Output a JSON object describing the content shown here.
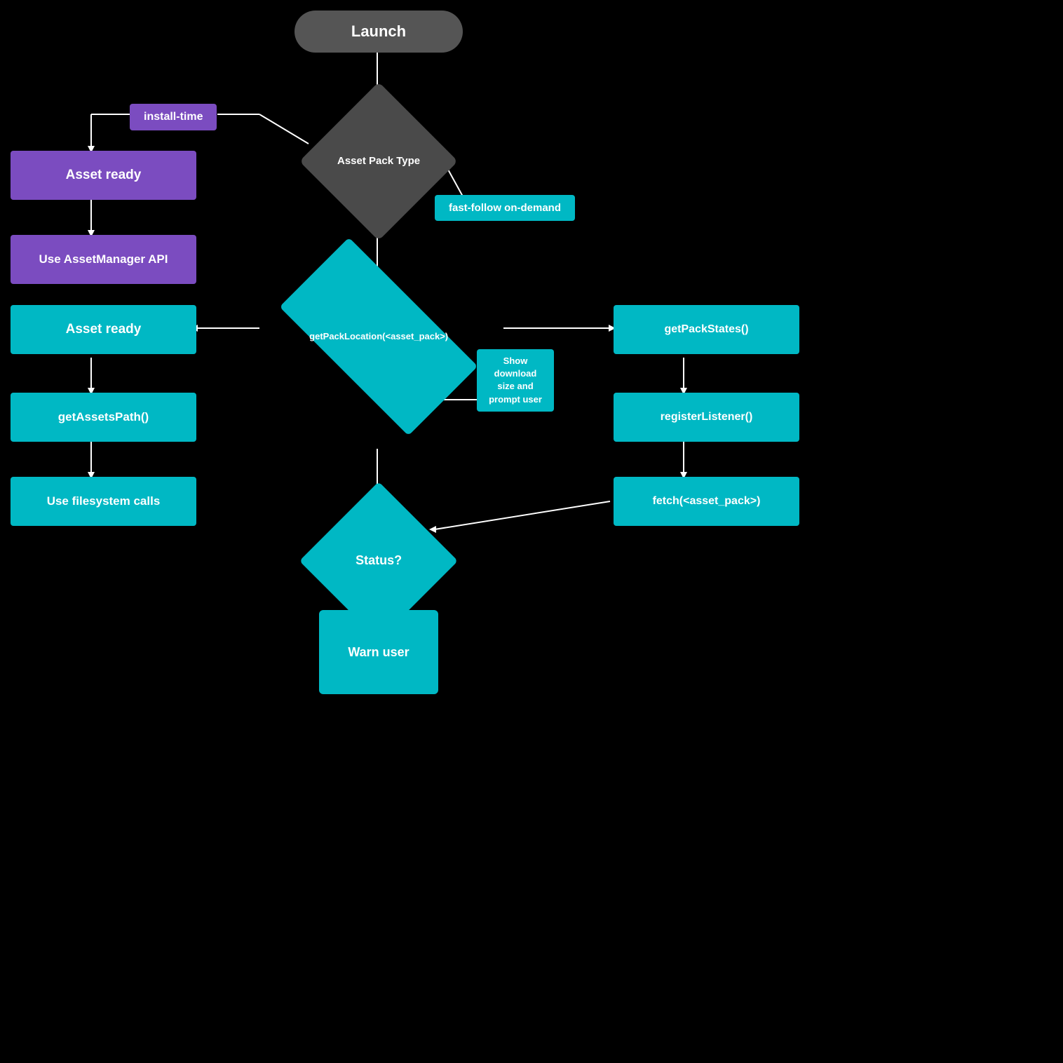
{
  "nodes": {
    "launch": {
      "label": "Launch"
    },
    "asset_pack_type": {
      "label": "Asset Pack\nType"
    },
    "install_time": {
      "label": "install-time"
    },
    "fast_follow": {
      "label": "fast-follow\non-demand"
    },
    "asset_ready_1": {
      "label": "Asset ready"
    },
    "use_asset_manager": {
      "label": "Use AssetManager API"
    },
    "get_pack_location": {
      "label": "getPackLocation(<asset_pack>)"
    },
    "asset_ready_2": {
      "label": "Asset ready"
    },
    "get_assets_path": {
      "label": "getAssetsPath()"
    },
    "use_filesystem": {
      "label": "Use filesystem calls"
    },
    "get_pack_states": {
      "label": "getPackStates()"
    },
    "register_listener": {
      "label": "registerListener()"
    },
    "fetch": {
      "label": "fetch(<asset_pack>)"
    },
    "show_download": {
      "label": "Show\ndownload\nsize and\nprompt\nuser"
    },
    "status": {
      "label": "Status?"
    },
    "warn_user": {
      "label": "Warn\nuser"
    }
  }
}
